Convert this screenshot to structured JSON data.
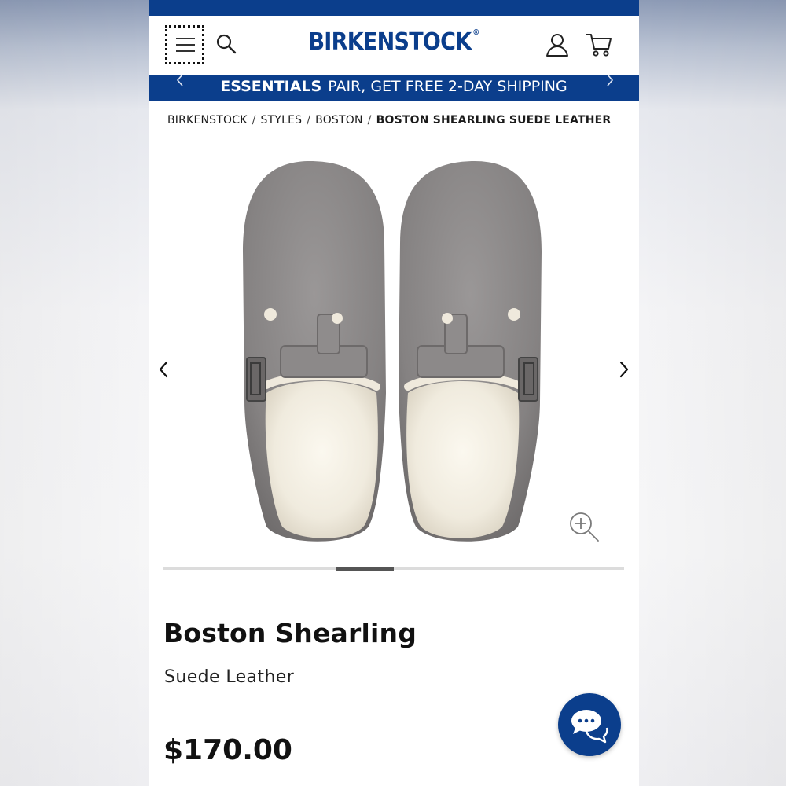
{
  "header": {
    "logo_text": "BIRKENSTOCK",
    "logo_mark": "®",
    "icons": [
      "menu-icon",
      "search-icon",
      "account-icon",
      "cart-icon"
    ]
  },
  "promo": {
    "bold": "ESSENTIALS",
    "text": "PAIR, GET FREE 2-DAY SHIPPING"
  },
  "breadcrumb": {
    "items": [
      "BIRKENSTOCK",
      "STYLES",
      "BOSTON"
    ],
    "current": "BOSTON SHEARLING SUEDE LEATHER",
    "separator": "/"
  },
  "gallery": {
    "image_count": 8,
    "active_index": 3
  },
  "product": {
    "name": "Boston Shearling",
    "subtitle": "Suede Leather",
    "price": "$170.00"
  },
  "colors": {
    "brand_blue": "#0b3e8c",
    "suede_gray": "#8a8787",
    "shearling": "#f3efe4"
  }
}
